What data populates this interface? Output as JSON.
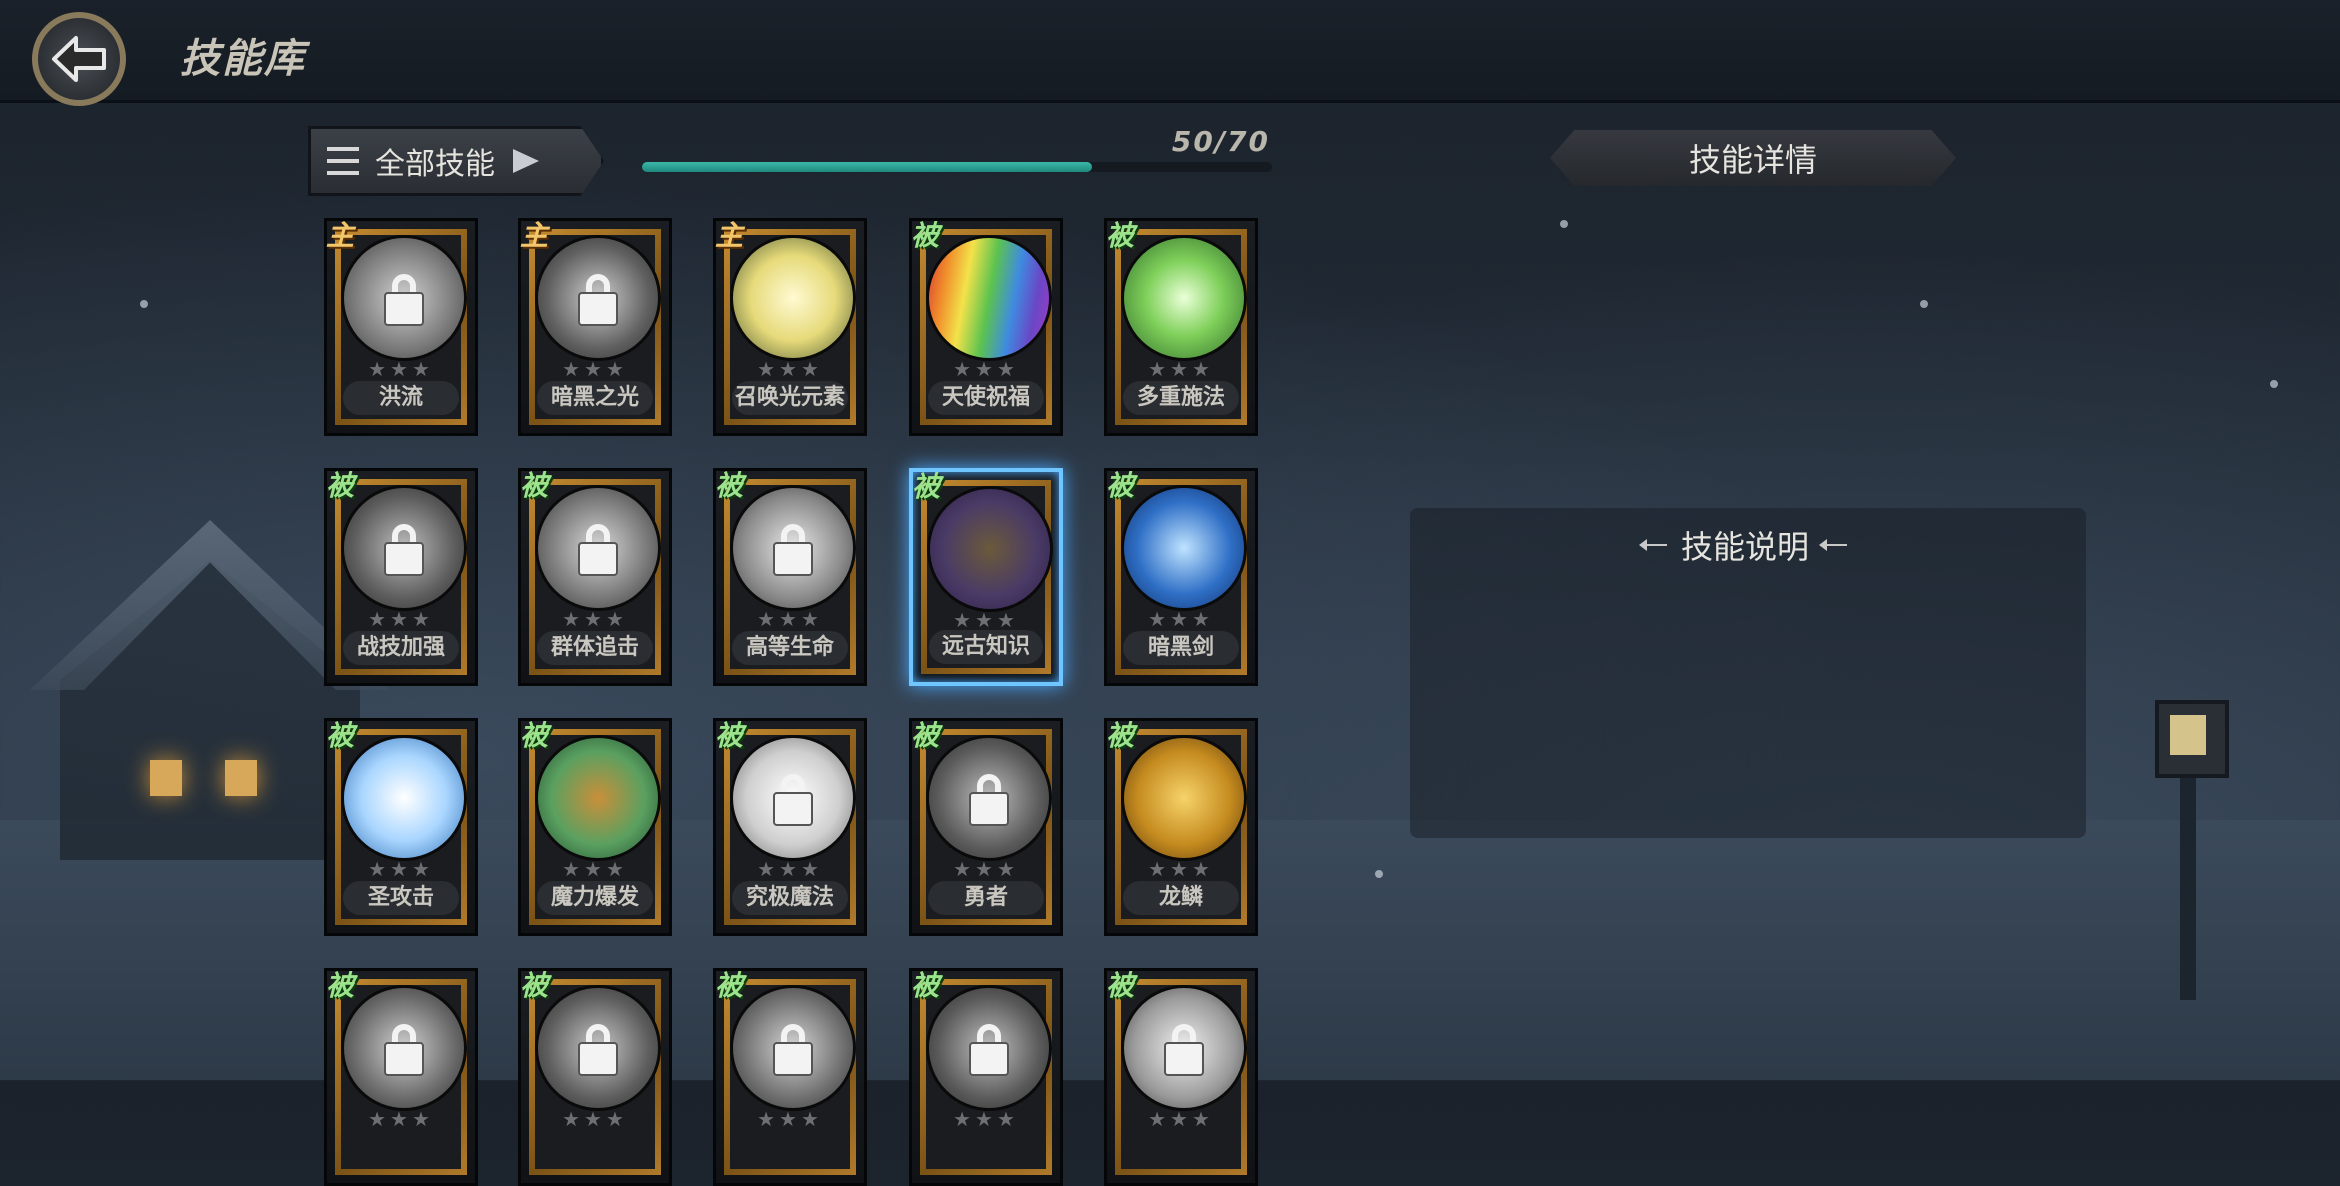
{
  "header": {
    "title": "技能库"
  },
  "filter": {
    "label": "全部技能"
  },
  "progress": {
    "text": "50/70",
    "current": 50,
    "total": 70
  },
  "detail": {
    "header": "技能详情",
    "section_title": "技能说明"
  },
  "colors": {
    "accent": "#3bb7a9",
    "selected_glow": "#6fc6ff",
    "frame_gold": "#c58b30"
  },
  "skills": [
    {
      "name": "洪流",
      "type": "主",
      "kind": "active",
      "locked": true,
      "icon": "wave-icon",
      "orb": "radial-gradient(circle,#d0d0d0,#7a7a7a 60%,#3a3a3a)"
    },
    {
      "name": "暗黑之光",
      "type": "主",
      "kind": "active",
      "locked": true,
      "icon": "dark-light-icon",
      "orb": "radial-gradient(circle,#cfcfcf,#606060 60%,#2a2a2a)"
    },
    {
      "name": "召唤光元素",
      "type": "主",
      "kind": "active",
      "locked": false,
      "icon": "light-element-icon",
      "orb": "radial-gradient(circle,#fffad2,#e6da7a 50%,#4e5a33)"
    },
    {
      "name": "天使祝福",
      "type": "被",
      "kind": "passive",
      "locked": false,
      "icon": "rainbow-icon",
      "orb": "linear-gradient(100deg,#d93a34 0%,#f08c2b 16%,#f3e24a 32%,#5cc34f 50%,#3f8be0 68%,#6a47c6 84%,#a23bc2 100%)"
    },
    {
      "name": "多重施法",
      "type": "被",
      "kind": "passive",
      "locked": false,
      "icon": "hands-icon",
      "orb": "radial-gradient(circle,#eaffd8,#7fd05a 45%,#2f6a2a)"
    },
    {
      "name": "战技加强",
      "type": "被",
      "kind": "passive",
      "locked": true,
      "icon": "claw-icon",
      "orb": "radial-gradient(circle,#bdbdbd,#5d5d5d 60%,#2a2a2a)"
    },
    {
      "name": "群体追击",
      "type": "被",
      "kind": "passive",
      "locked": true,
      "icon": "chase-icon",
      "orb": "radial-gradient(circle,#d8d8d8,#777 60%,#333)"
    },
    {
      "name": "高等生命",
      "type": "被",
      "kind": "passive",
      "locked": true,
      "icon": "chalice-icon",
      "orb": "radial-gradient(circle,#e8e8e8,#8a8a8a 60%,#3a3a3a)"
    },
    {
      "name": "远古知识",
      "type": "被",
      "kind": "passive",
      "locked": false,
      "selected": true,
      "icon": "rune-stone-icon",
      "orb": "radial-gradient(circle,#6b5a3a,#4a3b66 55%,#2b1e45)"
    },
    {
      "name": "暗黑剑",
      "type": "被",
      "kind": "passive",
      "locked": false,
      "icon": "dark-sword-icon",
      "orb": "radial-gradient(circle,#bfe3ff,#2f6fc6 55%,#102e66)"
    },
    {
      "name": "圣攻击",
      "type": "被",
      "kind": "passive",
      "locked": false,
      "icon": "holy-sword-icon",
      "orb": "radial-gradient(circle,#ffffff,#a9d6ff 50%,#2e6db5)"
    },
    {
      "name": "魔力爆发",
      "type": "被",
      "kind": "passive",
      "locked": false,
      "icon": "mana-swirl-icon",
      "orb": "radial-gradient(circle,#c98f3a,#5aa060 55%,#1f4a2e)"
    },
    {
      "name": "究极魔法",
      "type": "被",
      "kind": "passive",
      "locked": true,
      "icon": "ultimate-magic-icon",
      "orb": "radial-gradient(circle,#ffffff,#cfcfcf 55%,#6a6a6a)"
    },
    {
      "name": "勇者",
      "type": "被",
      "kind": "passive",
      "locked": true,
      "icon": "hero-icon",
      "orb": "radial-gradient(circle,#bdbdbd,#5b5b5b 60%,#2a2a2a)"
    },
    {
      "name": "龙鳞",
      "type": "被",
      "kind": "passive",
      "locked": false,
      "icon": "dragon-scale-icon",
      "orb": "radial-gradient(circle,#f6d36a,#c58b1f 55%,#5a3a10)"
    },
    {
      "name": "",
      "type": "被",
      "kind": "passive",
      "locked": true,
      "icon": "locked-skill-icon",
      "orb": "radial-gradient(circle,#d0d0d0,#6a6a6a 60%,#2c2c2c)"
    },
    {
      "name": "",
      "type": "被",
      "kind": "passive",
      "locked": true,
      "icon": "locked-skill-icon",
      "orb": "radial-gradient(circle,#c8c8c8,#5e5e5e 60%,#2a2a2a)"
    },
    {
      "name": "",
      "type": "被",
      "kind": "passive",
      "locked": true,
      "icon": "locked-skill-icon",
      "orb": "radial-gradient(circle,#d5d5d5,#6f6f6f 60%,#2d2d2d)"
    },
    {
      "name": "",
      "type": "被",
      "kind": "passive",
      "locked": true,
      "icon": "locked-skill-icon",
      "orb": "radial-gradient(circle,#c0c0c0,#5a5a5a 60%,#282828)"
    },
    {
      "name": "",
      "type": "被",
      "kind": "passive",
      "locked": true,
      "icon": "locked-skill-icon",
      "orb": "radial-gradient(circle,#f0f0f0,#9a9a9a 60%,#3c3c3c)"
    }
  ]
}
